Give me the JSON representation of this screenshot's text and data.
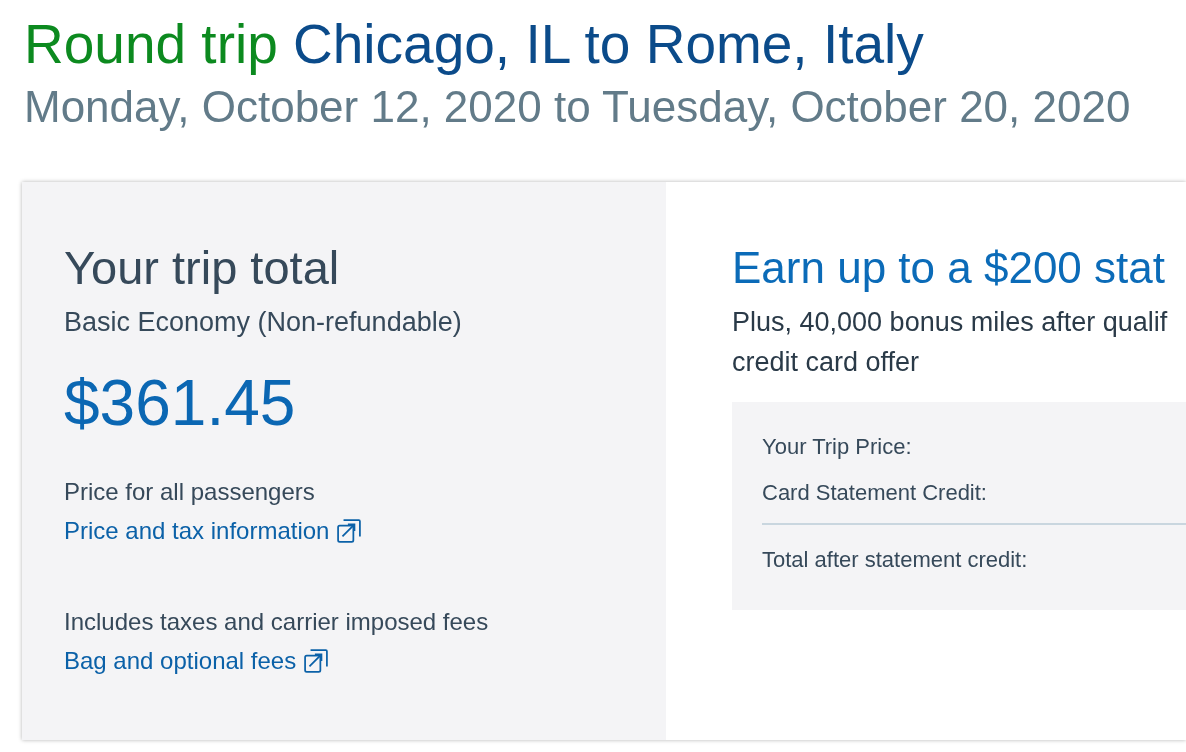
{
  "header": {
    "trip_type": "Round trip",
    "route": "Chicago, IL to Rome, Italy",
    "dates": "Monday, October 12, 2020 to Tuesday, October 20, 2020"
  },
  "trip_total": {
    "title": "Your trip total",
    "fare_class": "Basic Economy (Non-refundable)",
    "price": "$361.45",
    "sections": [
      {
        "note": "Price for all passengers",
        "link": "Price and tax information"
      },
      {
        "note": "Includes taxes and carrier imposed fees",
        "link": "Bag and optional fees"
      }
    ]
  },
  "card_offer": {
    "title": "Earn up to a $200 stat",
    "subtitle_lines": [
      "Plus, 40,000 bonus miles after qualif",
      "credit card offer"
    ],
    "summary_rows": [
      {
        "kind": "item",
        "label": "Your Trip Price:"
      },
      {
        "kind": "item",
        "label": "Card Statement Credit:"
      },
      {
        "kind": "total",
        "label": "Total after statement credit:"
      }
    ]
  }
}
